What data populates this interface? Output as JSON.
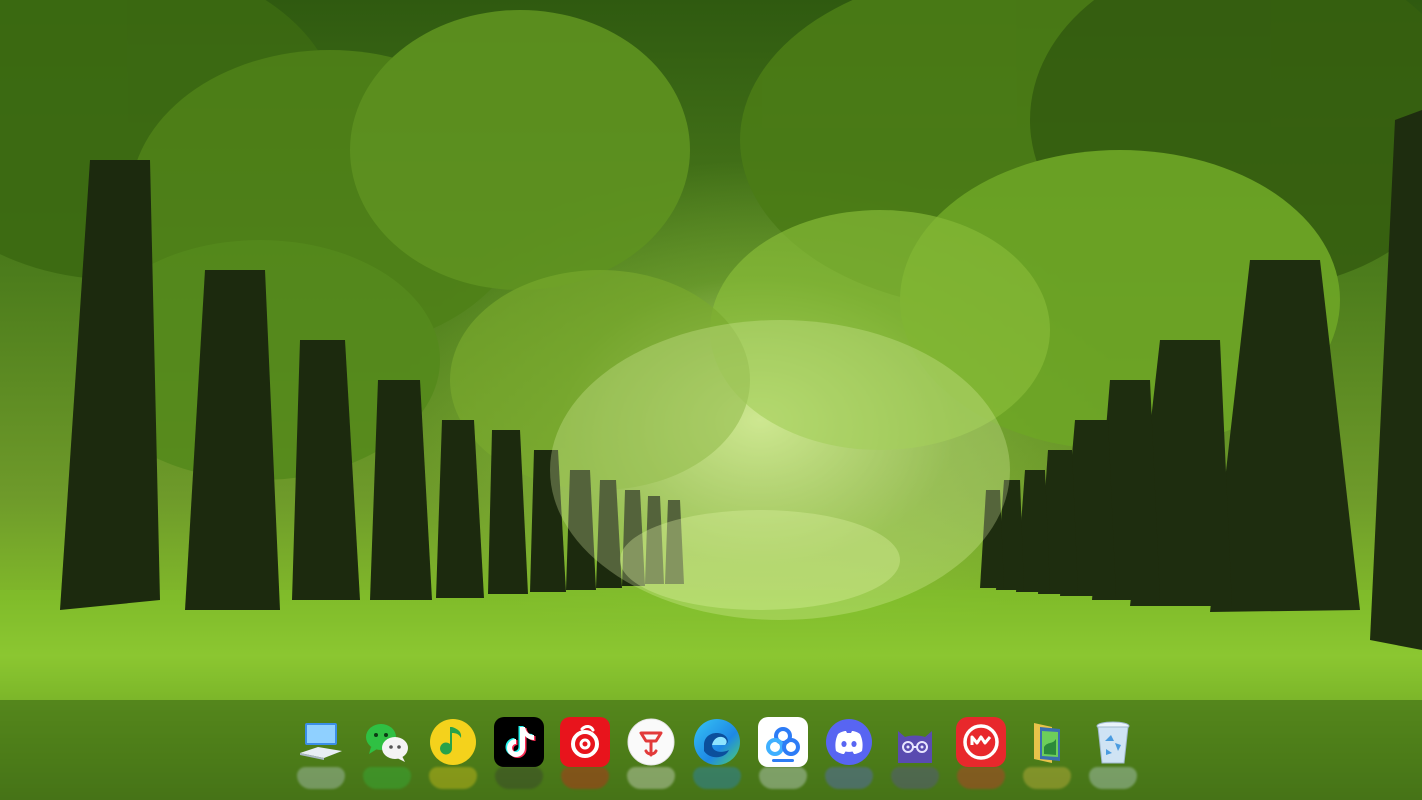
{
  "desktop": {
    "wallpaper": "forest-avenue",
    "colors": {
      "canopy": "#3f6d14",
      "light": "#d7f08e",
      "grass": "#8ccb30"
    }
  },
  "dock": {
    "items": [
      {
        "name": "computer",
        "icon": "computer-icon",
        "color": "#3b8ee8"
      },
      {
        "name": "wechat",
        "icon": "wechat-icon",
        "color": "#2fc043"
      },
      {
        "name": "qq-music",
        "icon": "music-note-icon",
        "color": "#f4d21c"
      },
      {
        "name": "tiktok",
        "icon": "tiktok-icon",
        "color": "#000000"
      },
      {
        "name": "netease-music",
        "icon": "netease-music-icon",
        "color": "#e8141c"
      },
      {
        "name": "pen-tool",
        "icon": "pen-icon",
        "color": "#e23a3a"
      },
      {
        "name": "edge-browser",
        "icon": "edge-icon",
        "color": "#1e88e5"
      },
      {
        "name": "baidu-netdisk",
        "icon": "cloud-icon",
        "color": "#2d7cf6"
      },
      {
        "name": "discord",
        "icon": "discord-icon",
        "color": "#5865f2"
      },
      {
        "name": "cat-app",
        "icon": "cat-icon",
        "color": "#5a4bb0"
      },
      {
        "name": "red-app",
        "icon": "red-app-icon",
        "color": "#e8282c"
      },
      {
        "name": "folder",
        "icon": "folder-icon",
        "color": "#e8c34a"
      },
      {
        "name": "recycle-bin",
        "icon": "trash-icon",
        "color": "#cfe3f4"
      }
    ]
  }
}
